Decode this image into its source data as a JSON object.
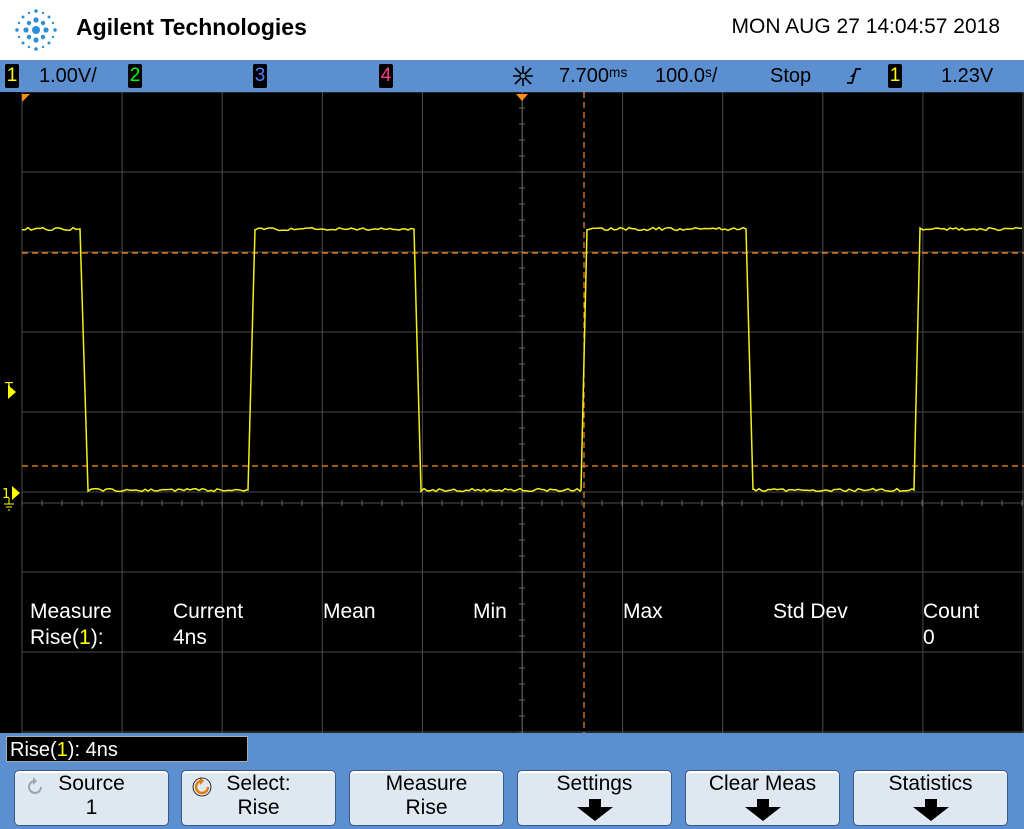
{
  "header": {
    "brand": "Agilent Technologies",
    "datetime": "MON AUG 27 14:04:57 2018"
  },
  "status_bar": {
    "ch1": {
      "number": "1",
      "scale": "1.00V/",
      "color": "#ffff00"
    },
    "ch2": {
      "number": "2",
      "color": "#00ff00"
    },
    "ch3": {
      "number": "3",
      "color": "#4a7dff"
    },
    "ch4": {
      "number": "4",
      "color": "#ff3c8c"
    },
    "delay": "7.700ᵐˢ",
    "timebase": "100.0ˢ/",
    "run_state": "Stop",
    "trigger_slope_icon": "rising-edge-icon",
    "trigger_source": "1",
    "trigger_level": "1.23V"
  },
  "screen": {
    "trigger_marker": "T",
    "ch1_ground_marker": "1",
    "measurements": {
      "headers": {
        "measure": "Measure",
        "current": "Current",
        "mean": "Mean",
        "min": "Min",
        "max": "Max",
        "std_dev": "Std Dev",
        "count": "Count"
      },
      "row": {
        "name_prefix": "Rise(",
        "source": "1",
        "name_suffix": "):",
        "current": "4ns",
        "count": "0"
      }
    }
  },
  "readout": {
    "prefix": "Rise(",
    "source": "1",
    "suffix": "): 4ns"
  },
  "softkeys": {
    "source": {
      "line1": "Source",
      "line2": "1"
    },
    "select": {
      "line1": "Select:",
      "line2": "Rise"
    },
    "measure": {
      "line1": "Measure",
      "line2": "Rise"
    },
    "settings": {
      "line1": "Settings"
    },
    "clear": {
      "line1": "Clear Meas"
    },
    "statistics": {
      "line1": "Statistics"
    }
  },
  "colors": {
    "ch1_trace": "#f2f21a",
    "cursor": "#ff8c1a",
    "grid": "#555555",
    "bar": "#5b8fd0"
  }
}
